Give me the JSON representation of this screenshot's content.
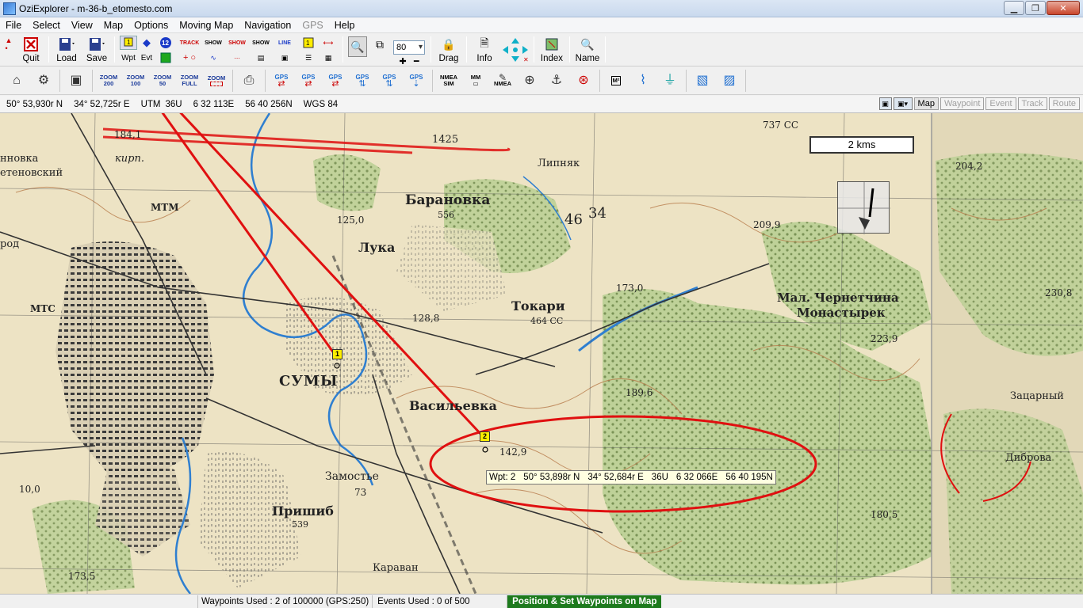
{
  "window": {
    "title": "OziExplorer - m-36-b_etomesto.com"
  },
  "menu": [
    "File",
    "Select",
    "View",
    "Map",
    "Options",
    "Moving Map",
    "Navigation",
    "GPS",
    "Help"
  ],
  "toolbar": {
    "quit": "Quit",
    "load": "Load",
    "save": "Save",
    "wpt": "Wpt",
    "evt": "Evt",
    "track": "TRACK",
    "show1": "SHOW",
    "show2": "SHOW",
    "show3": "SHOW",
    "line": "LINE",
    "zoom_value": "80",
    "drag": "Drag",
    "info": "Info",
    "index": "Index",
    "name": "Name"
  },
  "toolbar2": {
    "zoom200": [
      "ZOOM",
      "200"
    ],
    "zoom100": [
      "ZOOM",
      "100"
    ],
    "zoom50": [
      "ZOOM",
      "50"
    ],
    "zoomfull": [
      "ZOOM",
      "FULL"
    ],
    "zoom_blank": [
      "ZOOM",
      ""
    ],
    "gps_labels": [
      "GPS",
      "GPS",
      "GPS",
      "GPS",
      "GPS",
      "GPS"
    ],
    "nmea_sim": [
      "NMEA",
      "SIM"
    ],
    "mm": "MM",
    "nmea": "NMEA",
    "m2": "M²"
  },
  "coords": {
    "lat": "50° 53,930r N",
    "lon": "34° 52,725r E",
    "grid": "UTM",
    "zone": "36U",
    "easting": "6 32 113E",
    "northing": "56 40 256N",
    "datum": "WGS 84"
  },
  "view_tabs": [
    "Map",
    "Waypoint",
    "Event",
    "Track",
    "Route"
  ],
  "map": {
    "scale": "2 kms",
    "labels": {
      "baranovka": "Барановка",
      "sumy": "СУМЫ",
      "vasilevka": "Васильевка",
      "tokari": "Токари",
      "zamostye": "Замостье",
      "prishib": "Пришиб",
      "karavan": "Караван",
      "luka": "Лука",
      "chernechina": "Мал. Чернетчина",
      "monastyrek": "Монастырек",
      "zatsarny": "Зацарный",
      "dibrova": "Диброва",
      "lipnyak": "Липняк",
      "kirp": "кирп.",
      "mtm": "МТМ",
      "mts": "МТС",
      "novka": "нновка",
      "tenovsky": "етеновский",
      "rod": "род",
      "v1": "184,1",
      "v2": "142,9",
      "v3": "173,0",
      "v4": "128,8",
      "v5": "209,9",
      "v6": "223,9",
      "v7": "180,5",
      "v8": "539",
      "v9": "173,5",
      "v10": "230,8",
      "v11": "204,2",
      "v12": "189,6",
      "v13": "125,0",
      "v14": "1425",
      "v15": "46",
      "v16": "34",
      "v17": "737 СС",
      "v18": "10,0",
      "v19": "556",
      "v20": "464 СС",
      "v21": "73"
    },
    "waypoints": [
      {
        "number": "1"
      },
      {
        "number": "2"
      }
    ],
    "wpt_popup": {
      "name": "Wpt: 2",
      "lat": "50° 53,898r N",
      "lon": "34° 52,684r E",
      "zone": "36U",
      "easting": "6 32 066E",
      "northing": "56 40 195N"
    }
  },
  "status": {
    "waypoints": "Waypoints Used : 2 of 100000",
    "gps": "(GPS:250)",
    "events": "Events Used : 0 of 500",
    "mode": "Position & Set Waypoints on Map"
  },
  "colors": {
    "map_bg": "#ede3c4",
    "forest": "#a8c48a",
    "river": "#2f7fd0",
    "annotation": "#e01010",
    "status_green": "#1d7a1d"
  }
}
